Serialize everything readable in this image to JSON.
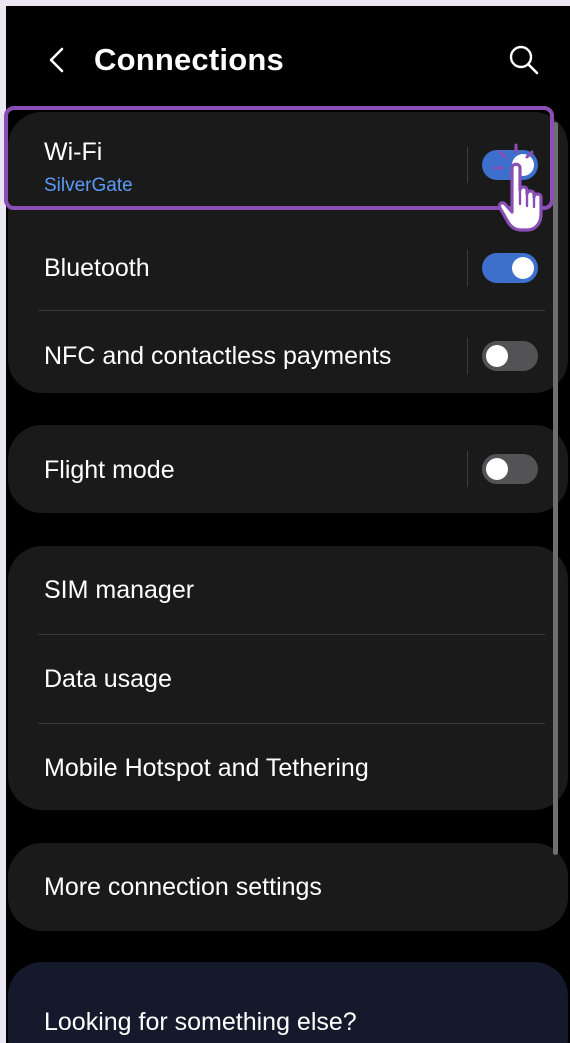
{
  "header": {
    "back_icon": "chevron-left-icon",
    "title": "Connections",
    "search_icon": "search-icon"
  },
  "connections_group": {
    "items": [
      {
        "label": "Wi-Fi",
        "sublabel": "SilverGate",
        "toggle": "on"
      },
      {
        "label": "Bluetooth",
        "toggle": "on"
      },
      {
        "label": "NFC and contactless payments",
        "toggle": "off"
      }
    ]
  },
  "flight_group": {
    "items": [
      {
        "label": "Flight mode",
        "toggle": "off"
      }
    ]
  },
  "network_group": {
    "items": [
      {
        "label": "SIM manager"
      },
      {
        "label": "Data usage"
      },
      {
        "label": "Mobile Hotspot and Tethering"
      }
    ]
  },
  "more_group": {
    "items": [
      {
        "label": "More connection settings"
      }
    ]
  },
  "footer": {
    "text": "Looking for something else?"
  },
  "overlay": {
    "pointer_icon": "tap-hand-icon",
    "highlight_color": "#8a4fb5"
  },
  "colors": {
    "background": "#000000",
    "card": "#1a1a1b",
    "toggle_on": "#3d6fcc",
    "toggle_off": "#535355",
    "accent_text": "#5b9bf5"
  }
}
